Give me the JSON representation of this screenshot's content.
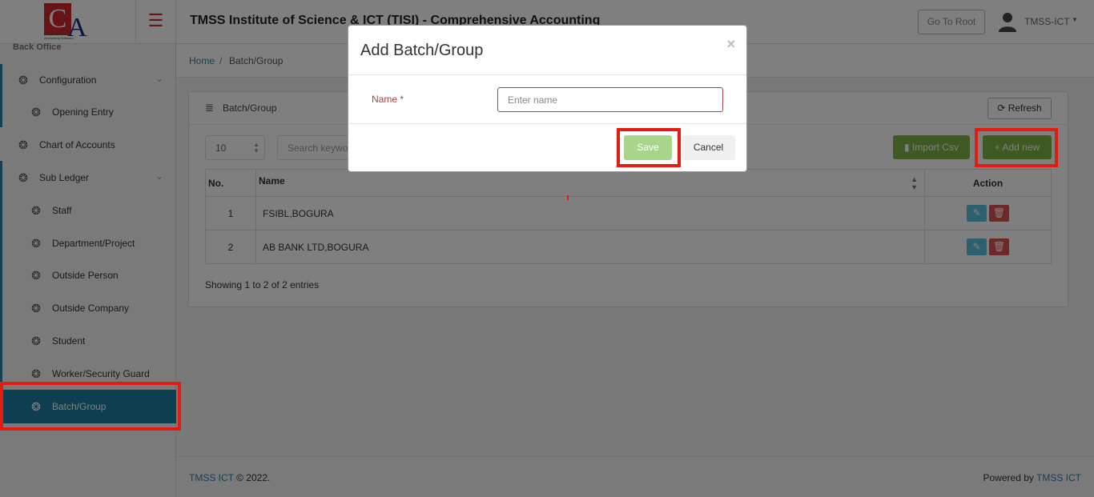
{
  "header": {
    "logo_text_c": "C",
    "logo_text_a": "A",
    "logo_tagline": "Comprehensive Accounting Software",
    "menu_icon": "hamburger-icon",
    "title": "TMSS Institute of Science & ICT (TISI) - Comprehensive Accounting",
    "goto_root_label": "Go To Root",
    "user_name": "TMSS-ICT",
    "user_icon": "user-avatar-icon"
  },
  "sidebar": {
    "section_label": "Back Office",
    "items": [
      {
        "label": "Configuration",
        "icon": "dropbox-icon",
        "has_children": true
      },
      {
        "label": "Opening Entry",
        "icon": "dropbox-icon"
      },
      {
        "label": "Chart of Accounts",
        "icon": "dropbox-icon"
      },
      {
        "label": "Sub Ledger",
        "icon": "dropbox-icon",
        "has_children": true
      },
      {
        "label": "Staff",
        "icon": "dropbox-icon"
      },
      {
        "label": "Department/Project",
        "icon": "dropbox-icon"
      },
      {
        "label": "Outside Person",
        "icon": "dropbox-icon"
      },
      {
        "label": "Outside Company",
        "icon": "dropbox-icon"
      },
      {
        "label": "Student",
        "icon": "dropbox-icon"
      },
      {
        "label": "Worker/Security Guard",
        "icon": "dropbox-icon"
      },
      {
        "label": "Batch/Group",
        "icon": "dropbox-icon",
        "active": true
      }
    ]
  },
  "breadcrumb": {
    "home": "Home",
    "separator": "/",
    "current": "Batch/Group"
  },
  "panel": {
    "title": "Batch/Group",
    "refresh_label": "Refresh",
    "page_size": "10",
    "search_placeholder": "Search keyword",
    "import_label": "Import Csv",
    "add_new_label": "Add new",
    "columns": [
      "No.",
      "Name",
      "Action"
    ],
    "rows": [
      {
        "no": "1",
        "name": "FSIBL,BOGURA"
      },
      {
        "no": "2",
        "name": "AB BANK LTD,BOGURA"
      }
    ],
    "showing_text": "Showing 1 to 2 of 2 entries"
  },
  "footer": {
    "brand": "TMSS ICT",
    "copyright": "© 2022.",
    "powered_by": "Powered by",
    "powered_brand": "TMSS ICT"
  },
  "modal": {
    "title": "Add Batch/Group",
    "close_symbol": "×",
    "name_label": "Name *",
    "name_placeholder": "Enter name",
    "name_value": "",
    "save_label": "Save",
    "cancel_label": "Cancel"
  },
  "colors": {
    "accent": "#1b7ea3",
    "success": "#7cb342",
    "danger": "#d9534f",
    "highlight": "#e41b10"
  }
}
